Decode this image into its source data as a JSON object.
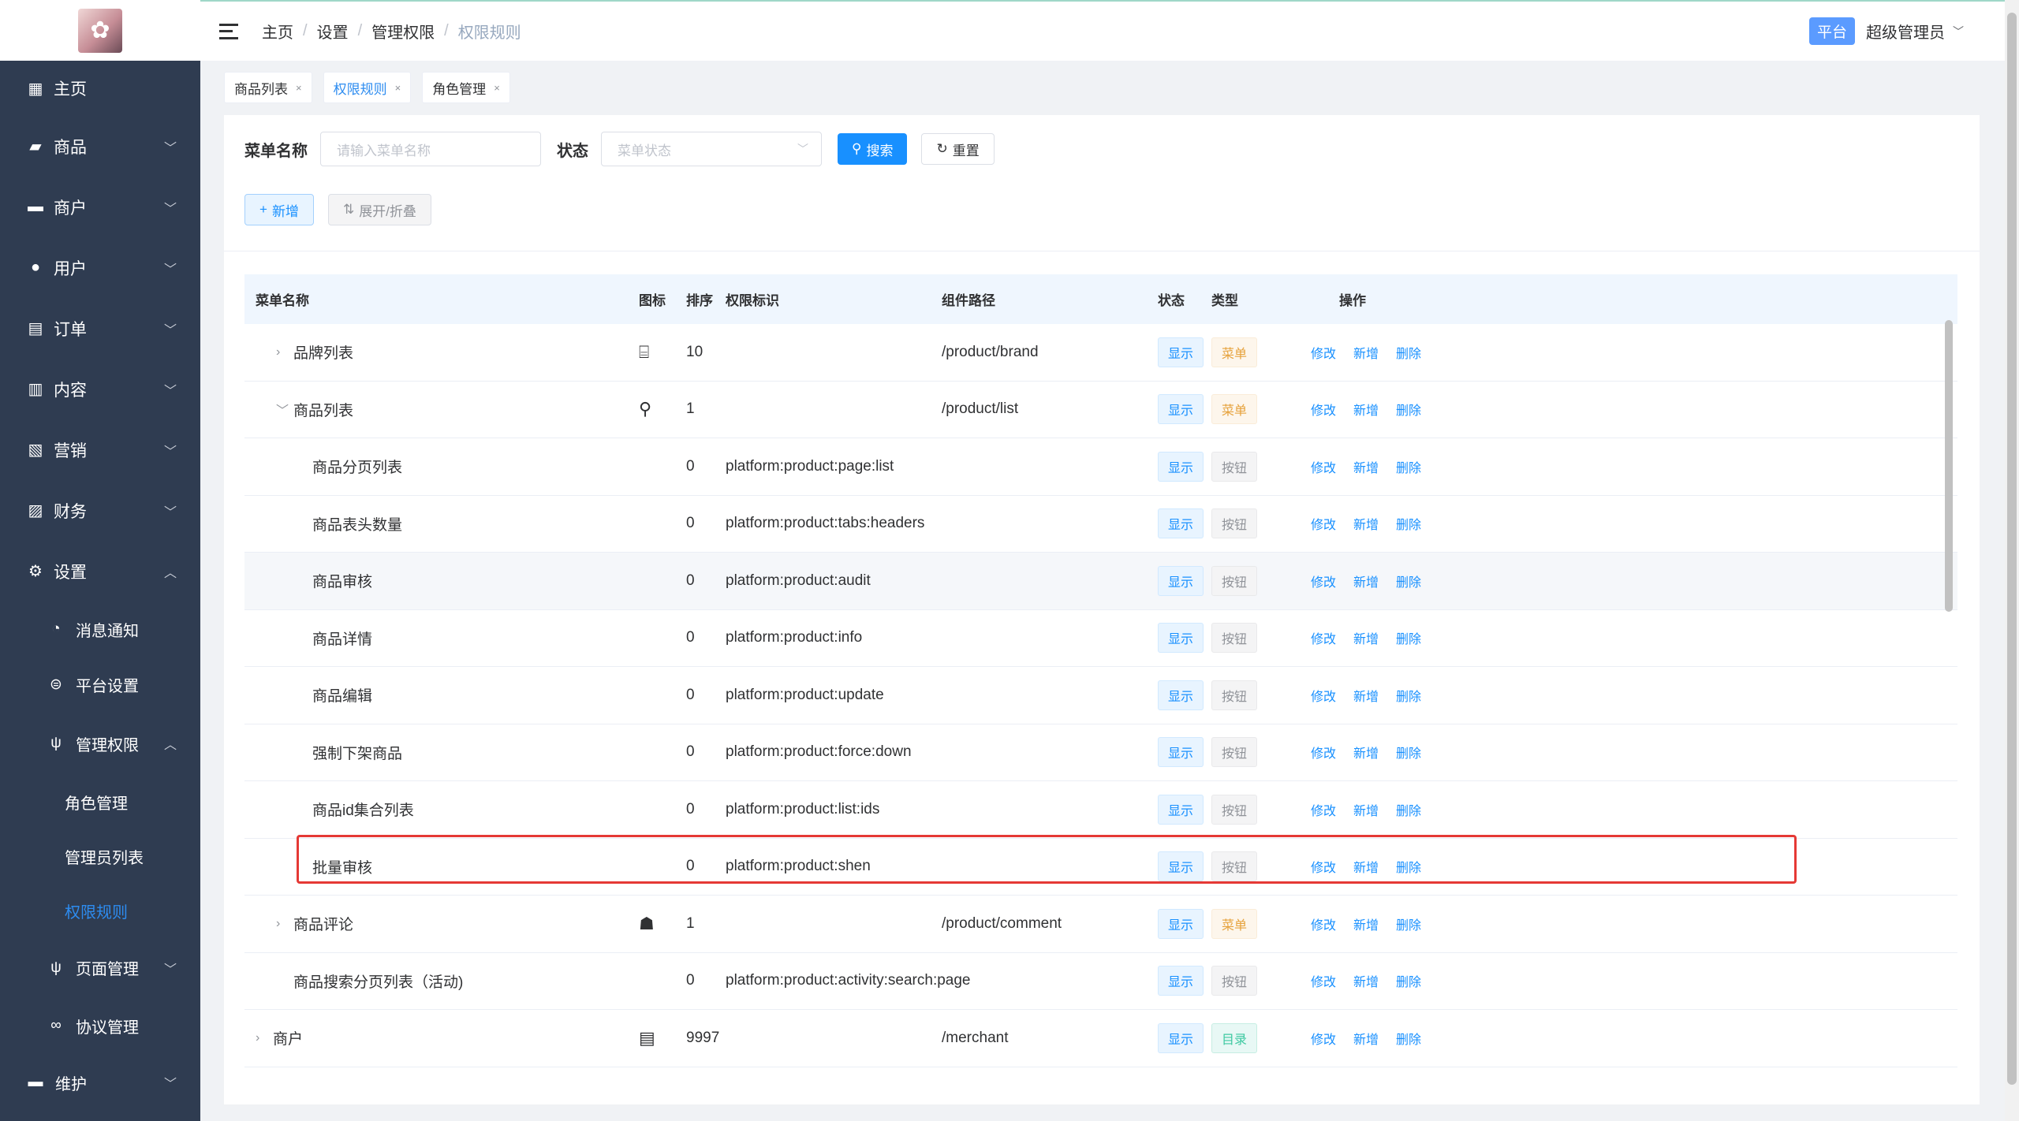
{
  "sidebar": {
    "items": [
      {
        "label": "主页",
        "icon": "grid-icon"
      },
      {
        "label": "商品",
        "icon": "bag-icon"
      },
      {
        "label": "商户",
        "icon": "store-icon"
      },
      {
        "label": "用户",
        "icon": "user-icon"
      },
      {
        "label": "订单",
        "icon": "clipboard-icon"
      },
      {
        "label": "内容",
        "icon": "book-icon"
      },
      {
        "label": "营销",
        "icon": "chart-icon"
      },
      {
        "label": "财务",
        "icon": "wallet-icon"
      },
      {
        "label": "设置",
        "icon": "gear-icon"
      }
    ],
    "settings_children": [
      {
        "label": "消息通知",
        "icon": "bell-icon"
      },
      {
        "label": "平台设置",
        "icon": "platform-icon"
      },
      {
        "label": "管理权限",
        "icon": "fork-icon"
      }
    ],
    "perm_children": [
      "角色管理",
      "管理员列表",
      "权限规则"
    ],
    "after": [
      {
        "label": "页面管理",
        "icon": "fork-icon"
      },
      {
        "label": "协议管理",
        "icon": "link-icon"
      },
      {
        "label": "维护",
        "icon": "tool-icon"
      }
    ]
  },
  "header": {
    "breadcrumb": [
      "主页",
      "设置",
      "管理权限",
      "权限规则"
    ],
    "platform_tag": "平台",
    "user_name": "超级管理员"
  },
  "tabs": [
    {
      "label": "商品列表",
      "active": false
    },
    {
      "label": "权限规则",
      "active": true
    },
    {
      "label": "角色管理",
      "active": false
    }
  ],
  "filter": {
    "name_label": "菜单名称",
    "name_placeholder": "请输入菜单名称",
    "status_label": "状态",
    "status_placeholder": "菜单状态",
    "search_btn": "搜索",
    "reset_btn": "重置",
    "add_btn": "新增",
    "expand_btn": "展开/折叠"
  },
  "table": {
    "headers": [
      "菜单名称",
      "图标",
      "排序",
      "权限标识",
      "组件路径",
      "状态",
      "类型",
      "操作"
    ],
    "ops": [
      "修改",
      "新增",
      "删除"
    ],
    "rows": [
      {
        "name": "品牌列表",
        "caret": ">",
        "level": 1,
        "icon": "⌸",
        "sort": "10",
        "perm": "",
        "path": "/product/brand",
        "status": "显示",
        "type": "菜单",
        "type_kind": "menu"
      },
      {
        "name": "商品列表",
        "caret": "v",
        "level": 1,
        "icon": "⚲",
        "sort": "1",
        "perm": "",
        "path": "/product/list",
        "status": "显示",
        "type": "菜单",
        "type_kind": "menu"
      },
      {
        "name": "商品分页列表",
        "caret": "",
        "level": 2,
        "icon": "",
        "sort": "0",
        "perm": "platform:product:page:list",
        "path": "",
        "status": "显示",
        "type": "按钮",
        "type_kind": "button"
      },
      {
        "name": "商品表头数量",
        "caret": "",
        "level": 2,
        "icon": "",
        "sort": "0",
        "perm": "platform:product:tabs:headers",
        "path": "",
        "status": "显示",
        "type": "按钮",
        "type_kind": "button"
      },
      {
        "name": "商品审核",
        "caret": "",
        "level": 2,
        "icon": "",
        "sort": "0",
        "perm": "platform:product:audit",
        "path": "",
        "status": "显示",
        "type": "按钮",
        "type_kind": "button"
      },
      {
        "name": "商品详情",
        "caret": "",
        "level": 2,
        "icon": "",
        "sort": "0",
        "perm": "platform:product:info",
        "path": "",
        "status": "显示",
        "type": "按钮",
        "type_kind": "button"
      },
      {
        "name": "商品编辑",
        "caret": "",
        "level": 2,
        "icon": "",
        "sort": "0",
        "perm": "platform:product:update",
        "path": "",
        "status": "显示",
        "type": "按钮",
        "type_kind": "button"
      },
      {
        "name": "强制下架商品",
        "caret": "",
        "level": 2,
        "icon": "",
        "sort": "0",
        "perm": "platform:product:force:down",
        "path": "",
        "status": "显示",
        "type": "按钮",
        "type_kind": "button"
      },
      {
        "name": "商品id集合列表",
        "caret": "",
        "level": 2,
        "icon": "",
        "sort": "0",
        "perm": "platform:product:list:ids",
        "path": "",
        "status": "显示",
        "type": "按钮",
        "type_kind": "button"
      },
      {
        "name": "批量审核",
        "caret": "",
        "level": 2,
        "icon": "",
        "sort": "0",
        "perm": "platform:product:shen",
        "path": "",
        "status": "显示",
        "type": "按钮",
        "type_kind": "button"
      },
      {
        "name": "商品评论",
        "caret": ">",
        "level": 1,
        "icon": "☗",
        "sort": "1",
        "perm": "",
        "path": "/product/comment",
        "status": "显示",
        "type": "菜单",
        "type_kind": "menu"
      },
      {
        "name": "商品搜索分页列表（活动)",
        "caret": "",
        "level": 1,
        "icon": "",
        "sort": "0",
        "perm": "platform:product:activity:search:page",
        "path": "",
        "status": "显示",
        "type": "按钮",
        "type_kind": "button"
      },
      {
        "name": "商户",
        "caret": ">",
        "level": 0,
        "icon": "▤",
        "sort": "9997",
        "perm": "",
        "path": "/merchant",
        "status": "显示",
        "type": "目录",
        "type_kind": "dir"
      }
    ]
  },
  "colors": {
    "sidebar_bg": "#2f3c51",
    "accent": "#1890ff",
    "highlight": "#e53935"
  }
}
